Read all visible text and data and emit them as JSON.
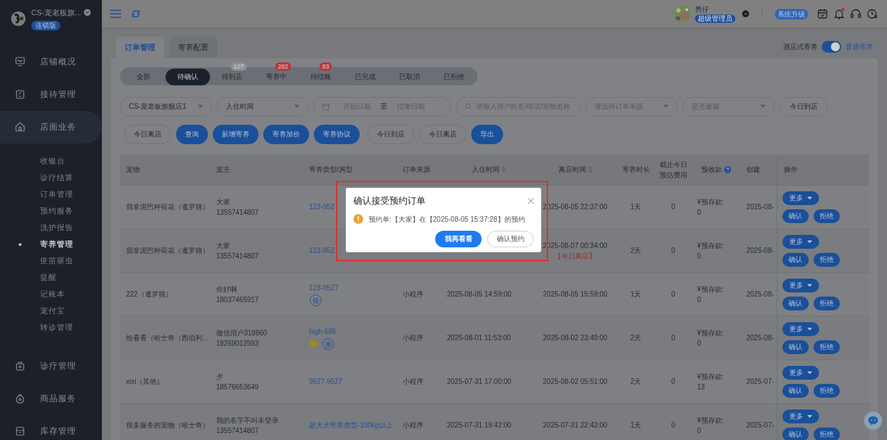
{
  "sidebar": {
    "store_name": "CS-宠老板旗...",
    "edition": "连锁版",
    "items": [
      {
        "label": "店铺概况",
        "selected": false
      },
      {
        "label": "接待管理",
        "selected": false
      },
      {
        "label": "店面业务",
        "selected": true,
        "children": [
          {
            "label": "收银台",
            "selected": false
          },
          {
            "label": "诊疗结算",
            "selected": false
          },
          {
            "label": "订单管理",
            "selected": false
          },
          {
            "label": "预约服务",
            "selected": false
          },
          {
            "label": "洗护报告",
            "selected": false
          },
          {
            "label": "寄养管理",
            "selected": true
          },
          {
            "label": "疫苗驱虫",
            "selected": false
          },
          {
            "label": "提醒",
            "selected": false
          },
          {
            "label": "记账本",
            "selected": false
          },
          {
            "label": "宠付宝",
            "selected": false
          },
          {
            "label": "转诊管理",
            "selected": false
          }
        ]
      },
      {
        "label": "诊疗管理",
        "selected": false
      },
      {
        "label": "商品服务",
        "selected": false
      },
      {
        "label": "库存管理",
        "selected": false
      }
    ]
  },
  "topbar": {
    "user_name": "男仔",
    "role": "超级管理员",
    "upgrade": "系统升级",
    "has_notification": true
  },
  "tabs": [
    {
      "label": "订单管理",
      "selected": true
    },
    {
      "label": "寄养配置",
      "selected": false
    }
  ],
  "mode_switch": {
    "left_label": "酒店式寄养",
    "on": true,
    "right_label": "普通寄养"
  },
  "status_tabs": [
    {
      "label": "全部",
      "selected": false
    },
    {
      "label": "待确认",
      "selected": true
    },
    {
      "label": "待到店",
      "selected": false,
      "badge": {
        "text": "107",
        "color": "#8e9094"
      }
    },
    {
      "label": "寄养中",
      "selected": false,
      "badge": {
        "text": "282",
        "color": "#b9373a"
      }
    },
    {
      "label": "待结账",
      "selected": false,
      "badge": {
        "text": "83",
        "color": "#b9373a"
      }
    },
    {
      "label": "已完成",
      "selected": false
    },
    {
      "label": "已取消",
      "selected": false
    },
    {
      "label": "已拒绝",
      "selected": false
    }
  ],
  "filters": [
    {
      "kind": "select",
      "value": "CS-宠老板旗舰店1"
    },
    {
      "kind": "select",
      "value": "入住时间"
    },
    {
      "kind": "daterange",
      "start_placeholder": "开始日期",
      "separator": "至",
      "end_placeholder": "结束日期"
    },
    {
      "kind": "search",
      "placeholder": "请输入用户姓名/电话/宠物名称"
    },
    {
      "kind": "select",
      "placeholder": "请选择订单来源"
    },
    {
      "kind": "select",
      "placeholder": "是否逾期"
    },
    {
      "kind": "button",
      "label": "今日到店"
    }
  ],
  "actions": [
    {
      "label": "今日离店",
      "kind": "outline"
    },
    {
      "label": "查询",
      "kind": "primary"
    },
    {
      "label": "新增寄养",
      "kind": "primary"
    },
    {
      "label": "寄养加价",
      "kind": "primary"
    },
    {
      "label": "寄养协议",
      "kind": "primary"
    },
    {
      "label": "今日到店",
      "kind": "outline"
    },
    {
      "label": "今日离店",
      "kind": "outline"
    },
    {
      "label": "导出",
      "kind": "primary"
    }
  ],
  "table": {
    "columns": [
      {
        "label": "宠物"
      },
      {
        "label": "宠主"
      },
      {
        "label": "寄养类型/房型"
      },
      {
        "label": "订单来源"
      },
      {
        "label": "入住时间",
        "sortable": true
      },
      {
        "label": "离店时间",
        "sortable": true
      },
      {
        "label": "寄养时长"
      },
      {
        "label": "截止今日",
        "label_2": "预估费用"
      },
      {
        "label": "预收款",
        "help": true
      },
      {
        "label": "创建"
      },
      {
        "label": "操作"
      }
    ],
    "rows": [
      {
        "pet": "我拿泥巴种荷花（暹罗猫）",
        "owner": "大家",
        "phone": "13557414807",
        "room": "123-952",
        "tags": [],
        "checkout": "2025-08-05 22:37:00",
        "duration": "1天",
        "fee": "0",
        "deposit_label": "¥预存款:",
        "deposit": "0",
        "created": "2025-08-",
        "more": "更多",
        "confirm": "确认",
        "reject": "拒绝"
      },
      {
        "pet": "我拿泥巴种荷花（暹罗猫）",
        "owner": "大家",
        "phone": "13557414807",
        "room": "123-952",
        "tags": [],
        "checkout": "2025-08-07 00:34:00",
        "note": "【今日离店】",
        "duration": "2天",
        "fee": "0",
        "deposit_label": "¥预存款:",
        "deposit": "0",
        "created": "2025-08-",
        "more": "更多",
        "confirm": "确认",
        "reject": "拒绝"
      },
      {
        "pet": "222（暹罗猫）",
        "owner": "你好啊",
        "phone": "18037465917",
        "room": "123-9527",
        "tags": [
          {
            "kind": "badge",
            "text": "接"
          }
        ],
        "source": "小程序",
        "checkin": "2025-08-05 14:59:00",
        "checkout": "2025-08-05 15:59:00",
        "duration": "1天",
        "fee": "0",
        "deposit_label": "¥预存款:",
        "deposit": "0",
        "created": "2025-08-",
        "more": "更多",
        "confirm": "确认",
        "reject": "拒绝"
      },
      {
        "pet": "给看看（哈士奇（西伯利...",
        "owner": "微信用户318860",
        "phone": "18269012593",
        "room": "high-685",
        "tags": [
          {
            "kind": "tag"
          },
          {
            "kind": "badge",
            "text": "接"
          }
        ],
        "source": "小程序",
        "checkin": "2025-08-01 11:53:00",
        "checkout": "2025-08-02 23:49:00",
        "duration": "2天",
        "fee": "0",
        "deposit_label": "¥预存款:",
        "deposit": "0",
        "created": "2025-08-",
        "more": "更多",
        "confirm": "确认",
        "reject": "拒绝"
      },
      {
        "pet": "xixi（其他）",
        "owner": "夕",
        "phone": "18576653649",
        "room": "9527-9527",
        "tags": [],
        "source": "小程序",
        "checkin": "2025-07-31 17:00:00",
        "checkout": "2025-08-02 05:51:00",
        "duration": "2天",
        "fee": "0",
        "deposit_label": "¥预存款:",
        "deposit": "13",
        "created": "2025-07-",
        "more": "更多",
        "confirm": "确认",
        "reject": "拒绝"
      },
      {
        "pet": "很多服务的宠物（哈士奇）",
        "owner": "我的名字不叫未登录",
        "phone": "13557414807",
        "room": "超大犬寄养类型-100kg以上",
        "tags": [],
        "source": "小程序",
        "checkin": "2025-07-31 19:42:00",
        "checkout": "2025-07-31 22:42:00",
        "duration": "1天",
        "fee": "0",
        "deposit_label": "¥预存款:",
        "deposit": "0",
        "created": "2025-07-",
        "more": "更多",
        "confirm": "确认",
        "reject": "拒绝"
      }
    ]
  },
  "dialog": {
    "title": "确认接受预约订单",
    "message": "预约单:【大家】在【2025-08-05 15:37:28】的预约",
    "buttons": [
      {
        "label": "我再看看",
        "kind": "primary"
      },
      {
        "label": "确认预约",
        "kind": "outline"
      }
    ],
    "highlighted": true
  }
}
